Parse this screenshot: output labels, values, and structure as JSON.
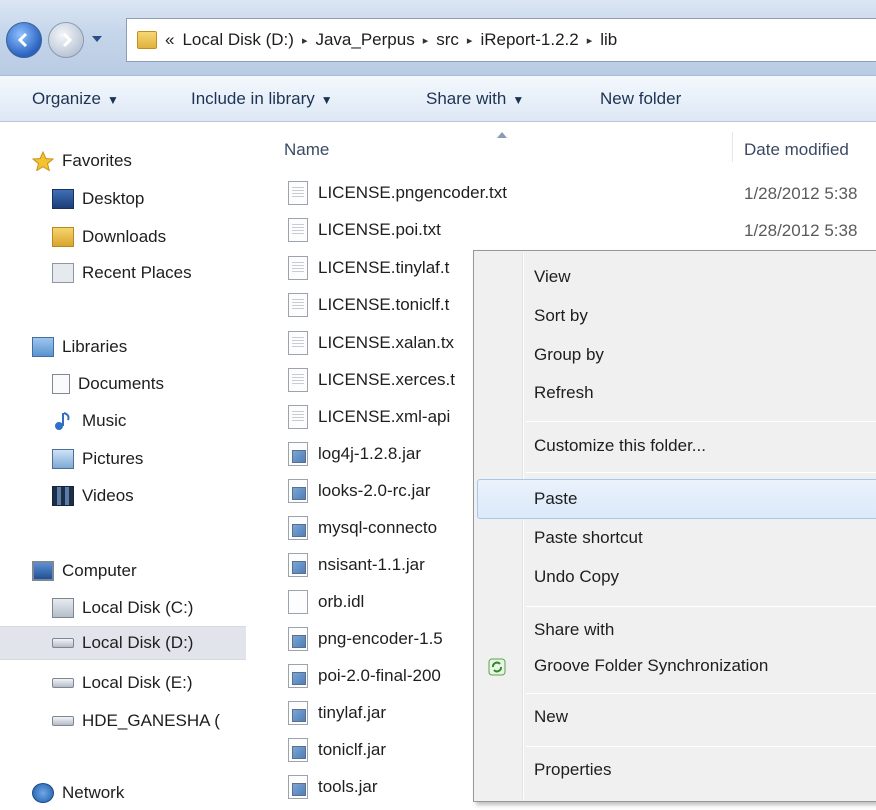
{
  "address": {
    "overflow": "«",
    "crumbs": [
      "Local Disk (D:)",
      "Java_Perpus",
      "src",
      "iReport-1.2.2",
      "lib"
    ],
    "separator": "▸"
  },
  "toolbar": {
    "organize": "Organize",
    "include": "Include in library",
    "share": "Share with",
    "new_folder": "New folder",
    "caret": "▼"
  },
  "nav": {
    "favorites": "Favorites",
    "desktop": "Desktop",
    "downloads": "Downloads",
    "recent": "Recent Places",
    "libraries": "Libraries",
    "documents": "Documents",
    "music": "Music",
    "pictures": "Pictures",
    "videos": "Videos",
    "computer": "Computer",
    "disk_c": "Local Disk (C:)",
    "disk_d": "Local Disk (D:)",
    "disk_e": "Local Disk (E:)",
    "hde": "HDE_GANESHA (",
    "network": "Network"
  },
  "columns": {
    "name": "Name",
    "date": "Date modified"
  },
  "files": [
    {
      "name": "LICENSE.pngencoder.txt",
      "type": "txt",
      "date": "1/28/2012 5:38"
    },
    {
      "name": "LICENSE.poi.txt",
      "type": "txt",
      "date": "1/28/2012 5:38"
    },
    {
      "name": "LICENSE.tinylaf.t",
      "type": "txt",
      "date": ""
    },
    {
      "name": "LICENSE.toniclf.t",
      "type": "txt",
      "date": ""
    },
    {
      "name": "LICENSE.xalan.tx",
      "type": "txt",
      "date": ""
    },
    {
      "name": "LICENSE.xerces.t",
      "type": "txt",
      "date": ""
    },
    {
      "name": "LICENSE.xml-api",
      "type": "txt",
      "date": ""
    },
    {
      "name": "log4j-1.2.8.jar",
      "type": "jar",
      "date": ""
    },
    {
      "name": "looks-2.0-rc.jar",
      "type": "jar",
      "date": ""
    },
    {
      "name": "mysql-connecto",
      "type": "jar",
      "date": ""
    },
    {
      "name": "nsisant-1.1.jar",
      "type": "jar",
      "date": ""
    },
    {
      "name": "orb.idl",
      "type": "blank",
      "date": ""
    },
    {
      "name": "png-encoder-1.5",
      "type": "jar",
      "date": ""
    },
    {
      "name": "poi-2.0-final-200",
      "type": "jar",
      "date": ""
    },
    {
      "name": "tinylaf.jar",
      "type": "jar",
      "date": ""
    },
    {
      "name": "toniclf.jar",
      "type": "jar",
      "date": ""
    },
    {
      "name": "tools.jar",
      "type": "jar",
      "date": ""
    }
  ],
  "menu": {
    "view": "View",
    "sort_by": "Sort by",
    "group_by": "Group by",
    "refresh": "Refresh",
    "customize": "Customize this folder...",
    "paste": "Paste",
    "paste_shortcut": "Paste shortcut",
    "undo_copy": "Undo Copy",
    "share_with": "Share with",
    "groove": "Groove Folder Synchronization",
    "new": "New",
    "properties": "Properties"
  },
  "colors": {
    "selection": "#dbe9f9",
    "toolbar_text": "#1e3354",
    "menu_bg": "#f0f0f0"
  }
}
